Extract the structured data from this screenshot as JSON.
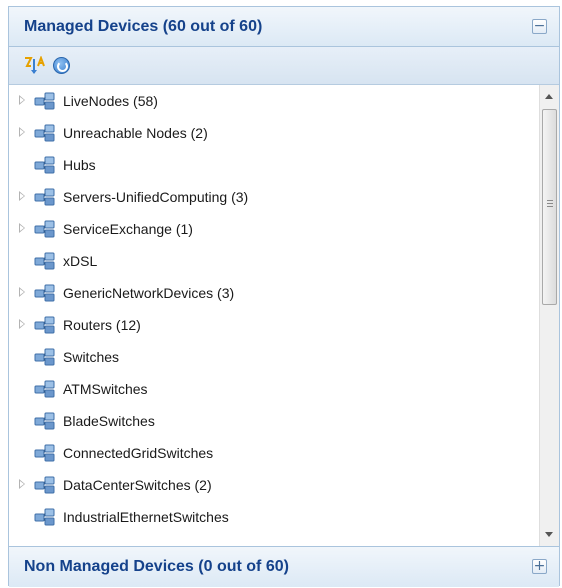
{
  "managed_panel": {
    "title": "Managed Devices (60 out of 60)",
    "toggle_symbol": "−"
  },
  "toolbar": {
    "icons": [
      "sort-icon",
      "refresh-icon"
    ]
  },
  "tree": {
    "items": [
      {
        "label": "LiveNodes (58)",
        "expandable": true
      },
      {
        "label": "Unreachable Nodes (2)",
        "expandable": true
      },
      {
        "label": "Hubs",
        "expandable": false
      },
      {
        "label": "Servers-UnifiedComputing (3)",
        "expandable": true
      },
      {
        "label": "ServiceExchange (1)",
        "expandable": true
      },
      {
        "label": "xDSL",
        "expandable": false
      },
      {
        "label": "GenericNetworkDevices (3)",
        "expandable": true
      },
      {
        "label": "Routers (12)",
        "expandable": true
      },
      {
        "label": "Switches",
        "expandable": false
      },
      {
        "label": "ATMSwitches",
        "expandable": false
      },
      {
        "label": "BladeSwitches",
        "expandable": false
      },
      {
        "label": "ConnectedGridSwitches",
        "expandable": false
      },
      {
        "label": "DataCenterSwitches (2)",
        "expandable": true
      },
      {
        "label": "IndustrialEthernetSwitches",
        "expandable": false
      }
    ]
  },
  "non_managed_panel": {
    "title": "Non Managed Devices (0 out of 60)",
    "toggle_symbol": "+"
  },
  "colors": {
    "header_text": "#15428b",
    "header_bg": "#dce9f5",
    "border": "#aac4dd"
  }
}
